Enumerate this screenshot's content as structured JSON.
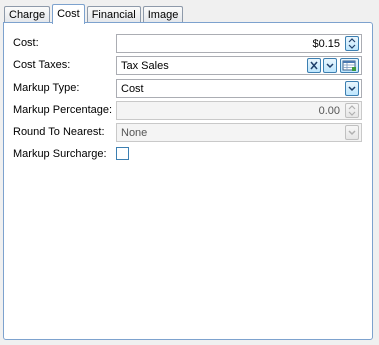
{
  "tabs": [
    {
      "label": "Charge"
    },
    {
      "label": "Cost"
    },
    {
      "label": "Financial"
    },
    {
      "label": "Image"
    }
  ],
  "active_tab": "Cost",
  "form": {
    "cost": {
      "label": "Cost:",
      "value": "$0.15"
    },
    "cost_taxes": {
      "label": "Cost Taxes:",
      "value": "Tax Sales"
    },
    "markup_type": {
      "label": "Markup Type:",
      "value": "Cost"
    },
    "markup_percentage": {
      "label": "Markup Percentage:",
      "value": "0.00"
    },
    "round_to_nearest": {
      "label": "Round To Nearest:",
      "value": "None"
    },
    "markup_surcharge": {
      "label": "Markup Surcharge:",
      "checked": false
    }
  },
  "colors": {
    "accent_border": "#7da2ce",
    "button_border": "#3c7fb1"
  },
  "icons": [
    "spin-up-down-icon",
    "clear-x-icon",
    "chevron-down-icon",
    "table-lookup-icon"
  ]
}
